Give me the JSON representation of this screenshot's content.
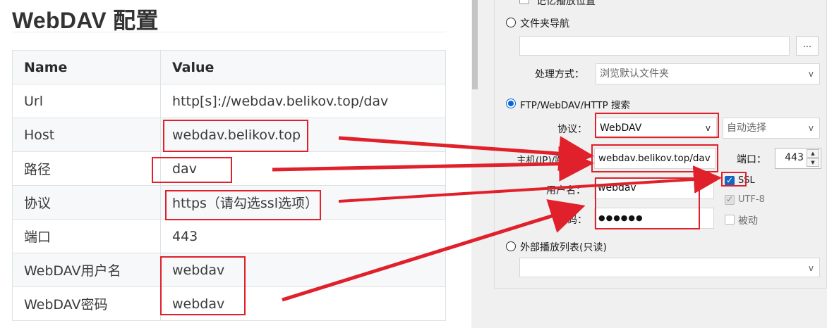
{
  "doc": {
    "title": "WebDAV 配置",
    "table": {
      "headers": [
        "Name",
        "Value"
      ],
      "rows": [
        {
          "name": "Url",
          "value": "http[s]://webdav.belikov.top/dav"
        },
        {
          "name": "Host",
          "value": "webdav.belikov.top"
        },
        {
          "name": "路径",
          "value": "dav"
        },
        {
          "name": "协议",
          "value": "https（请勾选ssl选项）"
        },
        {
          "name": "端口",
          "value": "443"
        },
        {
          "name": "WebDAV用户名",
          "value": "webdav"
        },
        {
          "name": "WebDAV密码",
          "value": "webdav"
        }
      ]
    }
  },
  "dialog": {
    "top_option": "记忆播放位置",
    "folder_nav": {
      "label": "文件夹导航",
      "path_value": "",
      "browse_label": "..."
    },
    "handling": {
      "label": "处理方式：",
      "value": "浏览默认文件夹"
    },
    "ftp": {
      "label": "FTP/WebDAV/HTTP 搜索",
      "protocol_label": "协议：",
      "protocol_value": "WebDAV",
      "encoding_value": "自动选择",
      "host_label": "主机(IP)/路径：",
      "host_value": "webdav.belikov.top/dav",
      "port_label": "端口：",
      "port_value": "443",
      "ssl_label": "SSL",
      "utf8_label": "UTF-8",
      "passive_label": "被动",
      "user_label": "用户名：",
      "user_value": "webdav",
      "pass_label": "密码：",
      "pass_value": "●●●●●●"
    },
    "external": {
      "label": "外部播放列表(只读)",
      "value": ""
    }
  },
  "colors": {
    "annotation": "#e0202a",
    "accent": "#0a64d8"
  },
  "icons": {
    "dropdown": "chevron-down-icon",
    "check": "check-icon"
  }
}
